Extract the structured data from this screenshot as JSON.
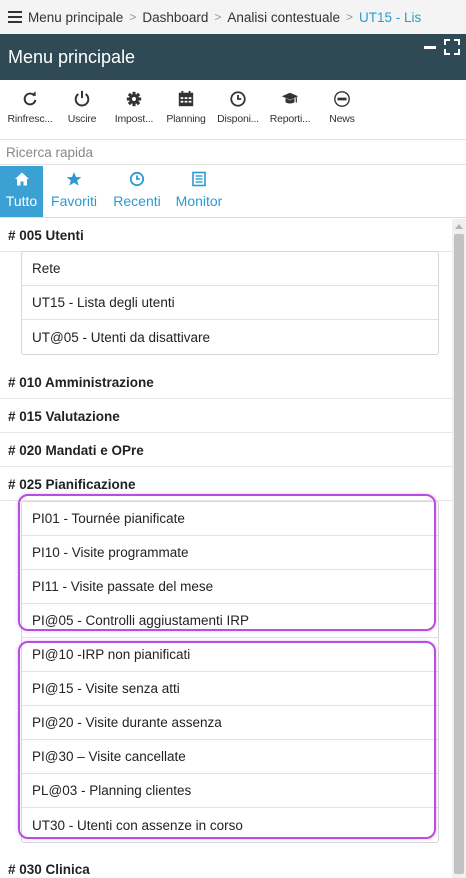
{
  "breadcrumb": {
    "items": [
      "Menu principale",
      "Dashboard",
      "Analisi contestuale"
    ],
    "current": "UT15 - Lis"
  },
  "window": {
    "title": "Menu principale"
  },
  "toolbar": {
    "refresh": "Rinfresc...",
    "logout": "Uscire",
    "settings": "Impost...",
    "planning": "Planning",
    "availability": "Disponi...",
    "reports": "Reporti...",
    "news": "News"
  },
  "search": {
    "placeholder": "Ricerca rapida"
  },
  "tabs": {
    "all": "Tutto",
    "favorites": "Favoriti",
    "recent": "Recenti",
    "monitor": "Monitor"
  },
  "menu": {
    "g005": {
      "title": "# 005 Utenti",
      "items": [
        "Rete",
        "UT15 - Lista degli utenti",
        "UT@05 - Utenti da disattivare"
      ]
    },
    "g010": {
      "title": "# 010 Amministrazione"
    },
    "g015": {
      "title": "# 015 Valutazione"
    },
    "g020": {
      "title": "# 020 Mandati e OPre"
    },
    "g025": {
      "title": "# 025 Pianificazione",
      "items": [
        "PI01 - Tournée pianificate",
        "PI10 - Visite programmate",
        "PI11 - Visite passate del mese",
        "PI@05 - Controlli aggiustamenti IRP",
        "PI@10 -IRP non pianificati",
        "PI@15 - Visite senza atti",
        "PI@20 - Visite durante assenza",
        "PI@30 – Visite cancellate",
        "PL@03 - Planning clientes",
        "UT30 - Utenti con assenze in corso"
      ]
    },
    "g030": {
      "title": "# 030 Clinica"
    }
  },
  "colors": {
    "titlebar": "#2f4a55",
    "accent": "#3ba0d4",
    "highlight": "#b74ee0"
  }
}
